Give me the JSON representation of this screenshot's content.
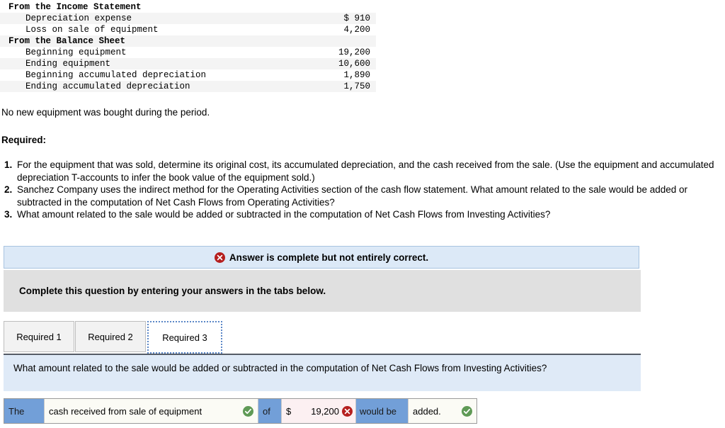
{
  "source_table": {
    "rows": [
      {
        "label": "From the Income Statement",
        "value": "",
        "bold": true,
        "indent": false,
        "shade": false
      },
      {
        "label": "Depreciation expense",
        "value": "$ 910",
        "bold": false,
        "indent": true,
        "shade": true
      },
      {
        "label": "Loss on sale of equipment",
        "value": "4,200",
        "bold": false,
        "indent": true,
        "shade": false
      },
      {
        "label": "From the Balance Sheet",
        "value": "",
        "bold": true,
        "indent": false,
        "shade": true
      },
      {
        "label": "Beginning equipment",
        "value": "19,200",
        "bold": false,
        "indent": true,
        "shade": false
      },
      {
        "label": "Ending equipment",
        "value": "10,600",
        "bold": false,
        "indent": true,
        "shade": true
      },
      {
        "label": "Beginning accumulated depreciation",
        "value": "1,890",
        "bold": false,
        "indent": true,
        "shade": false
      },
      {
        "label": "Ending accumulated depreciation",
        "value": "1,750",
        "bold": false,
        "indent": true,
        "shade": true
      }
    ]
  },
  "prose": {
    "note": "No new equipment was bought during the period.",
    "required_heading": "Required:",
    "requirements": [
      {
        "num": "1.",
        "text": "For the equipment that was sold, determine its original cost, its accumulated depreciation, and the cash received from the sale. (Use the equipment and accumulated depreciation T-accounts to infer the book value of the equipment sold.)"
      },
      {
        "num": "2.",
        "text": "Sanchez Company uses the indirect method for the Operating Activities section of the cash flow statement. What amount related to the sale would be added or subtracted in the computation of Net Cash Flows from Operating Activities?"
      },
      {
        "num": "3.",
        "text": "What amount related to the sale would be added or subtracted in the computation of Net Cash Flows from Investing Activities?"
      }
    ]
  },
  "answer_widget": {
    "alert": {
      "icon": "error-circle-icon",
      "message": "Answer is complete but not entirely correct."
    },
    "instruction": "Complete this question by entering your answers in the tabs below.",
    "tabs": [
      {
        "label": "Required 1",
        "active": false
      },
      {
        "label": "Required 2",
        "active": false
      },
      {
        "label": "Required 3",
        "active": true
      }
    ],
    "question": "What amount related to the sale would be added or subtracted in the computation of Net Cash Flows from Investing Activities?",
    "answer_row": {
      "prefix_label": "The",
      "description_value": "cash received from sale of equipment",
      "description_status": "correct",
      "of_label": "of",
      "currency_symbol": "$",
      "amount_value": "19,200",
      "amount_status": "incorrect",
      "would_be_label": "would be",
      "action_value": "added.",
      "action_status": "correct"
    }
  },
  "colors": {
    "alert_bg": "#dce9f7",
    "alert_border": "#a8c3e0",
    "instruction_bg": "#e0e0e0",
    "question_bg": "#dfeaf7",
    "static_cell_bg": "#729fd8",
    "input_cell_bg": "#fbfbf5",
    "error_cell_bg": "#fcf0f2",
    "correct_green": "#5f9a56",
    "error_red": "#b51f1f",
    "active_tab_border": "#5b87c7"
  }
}
